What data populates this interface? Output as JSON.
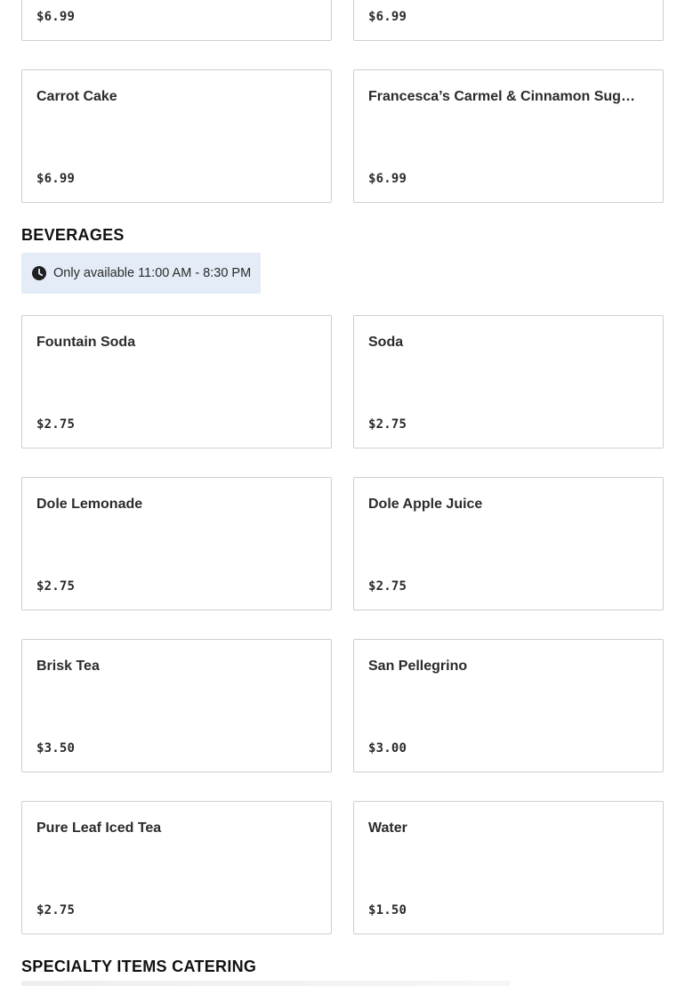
{
  "top_partial_cards": [
    {
      "price": "$6.99"
    },
    {
      "price": "$6.99"
    }
  ],
  "desserts_cards": [
    {
      "name": "Carrot Cake",
      "price": "$6.99"
    },
    {
      "name": "Francesca’s Carmel & Cinnamon Sugar…",
      "price": "$6.99"
    }
  ],
  "beverages": {
    "title": "BEVERAGES",
    "availability": "Only available 11:00 AM - 8:30 PM",
    "availability_icon": "clock-icon",
    "items": [
      {
        "name": "Fountain Soda",
        "price": "$2.75"
      },
      {
        "name": "Soda",
        "price": "$2.75"
      },
      {
        "name": "Dole Lemonade",
        "price": "$2.75"
      },
      {
        "name": "Dole Apple Juice",
        "price": "$2.75"
      },
      {
        "name": "Brisk Tea",
        "price": "$3.50"
      },
      {
        "name": "San Pellegrino",
        "price": "$3.00"
      },
      {
        "name": "Pure Leaf Iced Tea",
        "price": "$2.75"
      },
      {
        "name": "Water",
        "price": "$1.50"
      }
    ]
  },
  "specialty": {
    "title": "SPECIALTY ITEMS CATERING"
  },
  "colors": {
    "availability_bg": "#e3ecf7",
    "card_border": "#cfcfcf",
    "text": "#2b2b2b"
  }
}
